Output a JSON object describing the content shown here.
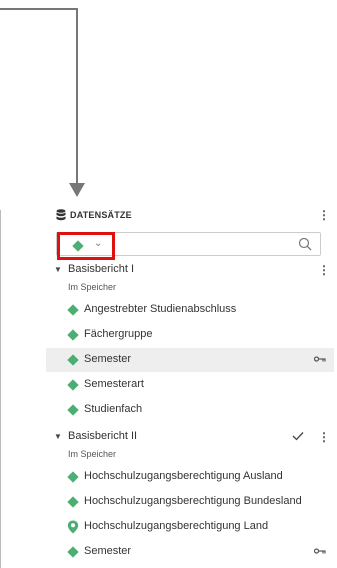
{
  "panel": {
    "title": "DATENSÄTZE",
    "search_placeholder": "",
    "filter_icon": "diamond-icon",
    "accent_color": "#4cae73",
    "highlight_color": "#e01010"
  },
  "groups": [
    {
      "label": "Basisbericht I",
      "sublabel": "Im Speicher",
      "items": [
        {
          "label": "Angestrebter Studienabschluss",
          "icon": "diamond-icon"
        },
        {
          "label": "Fächergruppe",
          "icon": "diamond-icon"
        },
        {
          "label": "Semester",
          "icon": "diamond-icon",
          "selected": true,
          "key": true
        },
        {
          "label": "Semesterart",
          "icon": "diamond-icon"
        },
        {
          "label": "Studienfach",
          "icon": "diamond-icon"
        }
      ]
    },
    {
      "label": "Basisbericht II",
      "sublabel": "Im Speicher",
      "checked": true,
      "items": [
        {
          "label": "Hochschulzugangsberechtigung Ausland",
          "icon": "diamond-icon"
        },
        {
          "label": "Hochschulzugangsberechtigung Bundesland",
          "icon": "diamond-icon"
        },
        {
          "label": "Hochschulzugangsberechtigung Land",
          "icon": "map-pin-icon"
        },
        {
          "label": "Semester",
          "icon": "diamond-icon",
          "key": true
        }
      ]
    }
  ]
}
